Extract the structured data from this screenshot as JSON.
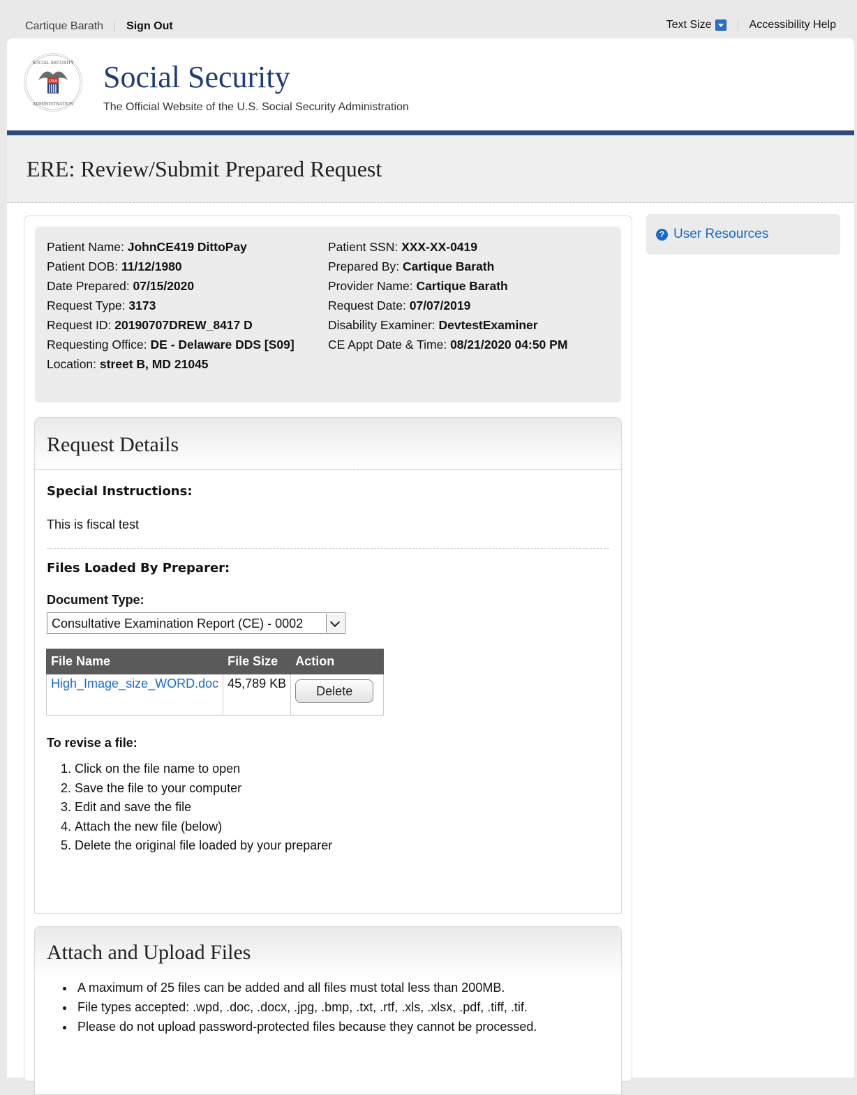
{
  "utility": {
    "user_name": "Cartique Barath",
    "sign_out": "Sign Out",
    "text_size": "Text Size",
    "accessibility_help": "Accessibility Help"
  },
  "header": {
    "site_title": "Social Security",
    "tagline": "The Official Website of the U.S. Social Security Administration",
    "seal_text_top": "SOCIAL SECURITY",
    "seal_text_bottom": "ADMINISTRATION",
    "seal_flag_text": "USA"
  },
  "page": {
    "title": "ERE: Review/Submit Prepared Request"
  },
  "patient_info": {
    "col1": [
      {
        "label": "Patient Name: ",
        "value": "JohnCE419 DittoPay"
      },
      {
        "label": "Patient DOB: ",
        "value": "11/12/1980"
      },
      {
        "label": "Date Prepared: ",
        "value": "07/15/2020"
      },
      {
        "label": "Request Type: ",
        "value": "3173"
      },
      {
        "label": "Request ID: ",
        "value": "20190707DREW_8417 D"
      },
      {
        "label": "Requesting Office: ",
        "value": "DE - Delaware DDS [S09]"
      },
      {
        "label": "Location: ",
        "value": "street B, MD 21045"
      }
    ],
    "col2": [
      {
        "label": "Patient SSN: ",
        "value": "XXX-XX-0419"
      },
      {
        "label": "Prepared By: ",
        "value": "Cartique Barath"
      },
      {
        "label": "Provider Name: ",
        "value": "Cartique Barath"
      },
      {
        "label": "Request Date: ",
        "value": "07/07/2019"
      },
      {
        "label": "Disability Examiner: ",
        "value": "DevtestExaminer"
      },
      {
        "label": "CE Appt Date & Time: ",
        "value": "08/21/2020 04:50 PM"
      }
    ]
  },
  "request_details": {
    "title": "Request Details",
    "special_instructions_heading": "Special Instructions:",
    "special_instructions_text": "This is fiscal test",
    "files_heading": "Files Loaded By Preparer:",
    "document_type_label": "Document Type:",
    "document_type_value": "Consultative Examination Report (CE) - 0002",
    "table_headers": [
      "File Name",
      "File Size",
      "Action"
    ],
    "files": [
      {
        "name": "High_Image_size_WORD.doc",
        "size": "45,789 KB",
        "action": "Delete"
      }
    ],
    "revise_heading": "To revise a file:",
    "revise_steps": [
      "Click on the file name to open",
      "Save the file to your computer",
      "Edit and save the file",
      "Attach the new file (below)",
      "Delete the original file loaded by your preparer"
    ]
  },
  "attach": {
    "title": "Attach and Upload Files",
    "rules": [
      "A maximum of 25 files can be added and all files must total less than 200MB.",
      "File types accepted: .wpd, .doc, .docx, .jpg, .bmp, .txt, .rtf, .xls, .xlsx, .pdf, .tiff, .tif.",
      "Please do not upload password-protected files because they cannot be processed."
    ]
  },
  "sidebar": {
    "user_resources": "User Resources",
    "help_icon_glyph": "?"
  }
}
